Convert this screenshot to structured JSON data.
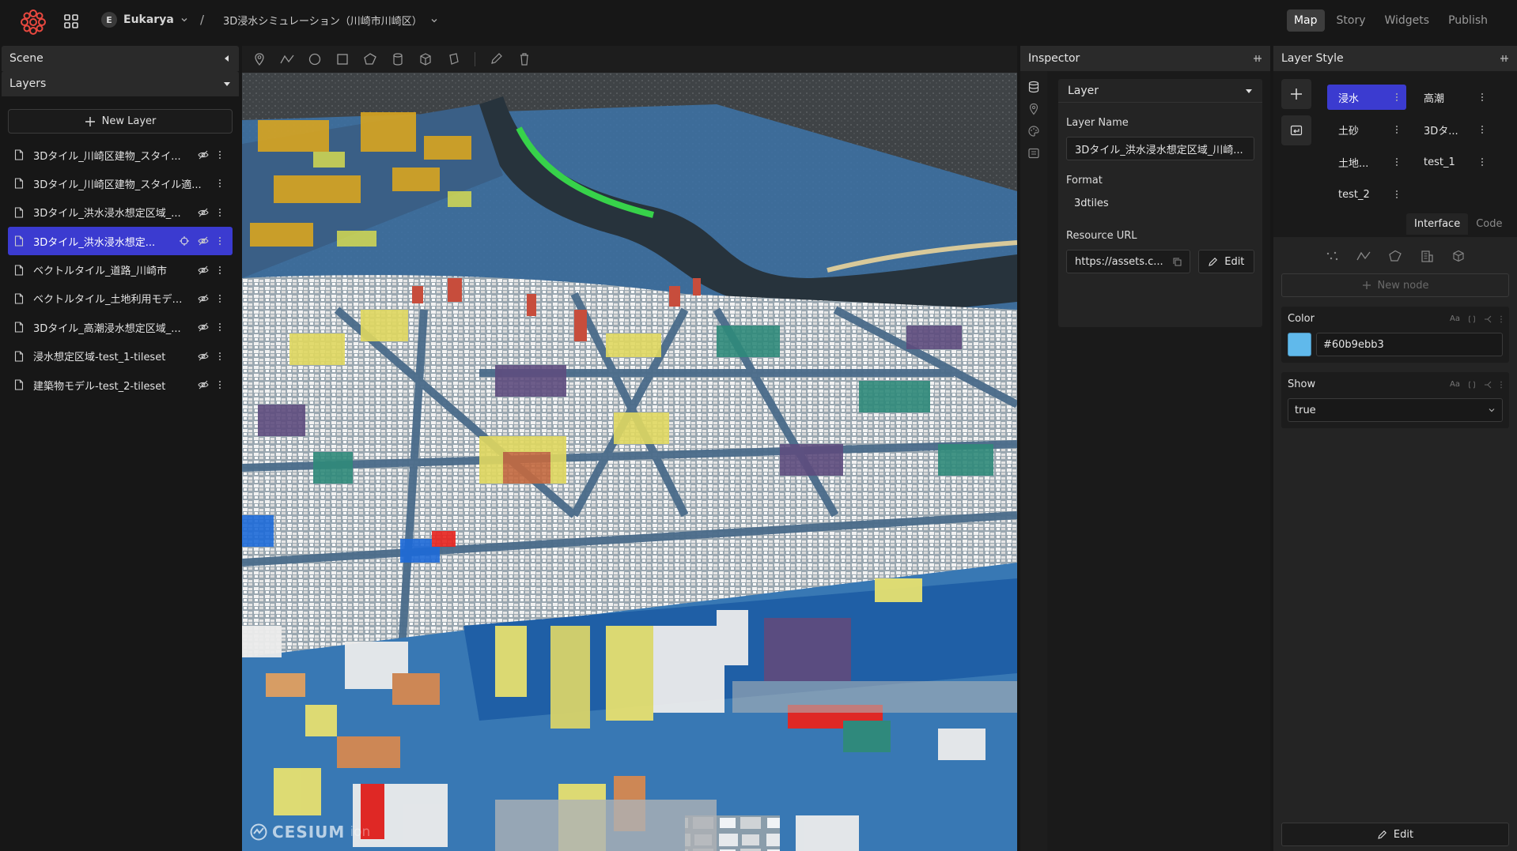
{
  "header": {
    "workspace_initial": "E",
    "workspace_name": "Eukarya",
    "separator": "/",
    "project_name": "3D浸水シミュレーション（川崎市川崎区）",
    "tabs": [
      {
        "label": "Map",
        "active": true
      },
      {
        "label": "Story",
        "active": false
      },
      {
        "label": "Widgets",
        "active": false
      },
      {
        "label": "Publish",
        "active": false
      }
    ]
  },
  "left": {
    "scene_title": "Scene",
    "layers_title": "Layers",
    "new_layer_label": "New Layer",
    "layers": [
      {
        "name": "3Dタイル_川崎区建物_スタイ...",
        "visible_icon": true,
        "selected": false
      },
      {
        "name": "3Dタイル_川崎区建物_スタイル適...",
        "visible_icon": false,
        "selected": false
      },
      {
        "name": "3Dタイル_洪水浸水想定区域_...",
        "visible_icon": true,
        "selected": false
      },
      {
        "name": "3Dタイル_洪水浸水想定...",
        "visible_icon": true,
        "selected": true
      },
      {
        "name": "ベクトルタイル_道路_川崎市",
        "visible_icon": true,
        "selected": false
      },
      {
        "name": "ベクトルタイル_土地利用モデル_...",
        "visible_icon": true,
        "selected": false
      },
      {
        "name": "3Dタイル_高潮浸水想定区域_...",
        "visible_icon": true,
        "selected": false
      },
      {
        "name": "浸水想定区域-test_1-tileset",
        "visible_icon": true,
        "selected": false
      },
      {
        "name": "建築物モデル-test_2-tileset",
        "visible_icon": true,
        "selected": false
      }
    ]
  },
  "map": {
    "credit_logo": "CESIUM",
    "credit_text": "ion"
  },
  "inspector": {
    "title": "Inspector",
    "section": "Layer",
    "layer_name_label": "Layer Name",
    "layer_name_value": "3Dタイル_洪水浸水想定区域_川崎...",
    "format_label": "Format",
    "format_value": "3dtiles",
    "resource_url_label": "Resource URL",
    "resource_url_value": "https://assets.c...",
    "edit_label": "Edit"
  },
  "layer_style": {
    "title": "Layer Style",
    "styles": [
      {
        "name": "浸水",
        "active": true
      },
      {
        "name": "高潮",
        "active": false
      },
      {
        "name": "土砂",
        "active": false
      },
      {
        "name": "3Dタ...",
        "active": false
      },
      {
        "name": "土地...",
        "active": false
      },
      {
        "name": "test_1",
        "active": false
      },
      {
        "name": "test_2",
        "active": false
      }
    ],
    "tabs": [
      {
        "label": "Interface",
        "active": true
      },
      {
        "label": "Code",
        "active": false
      }
    ],
    "new_node_label": "New node",
    "color_label": "Color",
    "color_value": "#60b9ebb3",
    "color_swatch": "#60b9eb",
    "show_label": "Show",
    "show_value": "true",
    "prop_icon_text": "Aa",
    "edit_label": "Edit"
  },
  "colors": {
    "accent": "#3b3bd0",
    "background": "#171717",
    "panel": "#1d1d1d"
  }
}
